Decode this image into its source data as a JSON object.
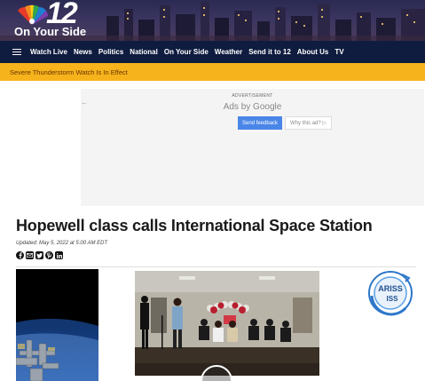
{
  "brand": {
    "channel_number": "12",
    "tagline": "On Your Side"
  },
  "nav": {
    "items": [
      {
        "label": "Watch Live"
      },
      {
        "label": "News"
      },
      {
        "label": "Politics"
      },
      {
        "label": "National"
      },
      {
        "label": "On Your Side"
      },
      {
        "label": "Weather"
      },
      {
        "label": "Send it to 12"
      },
      {
        "label": "About Us"
      },
      {
        "label": "TV"
      }
    ]
  },
  "alert": {
    "text": "Severe Thunderstorm Watch Is In Effect"
  },
  "ad": {
    "label": "ADVERTISEMENT",
    "ads_by": "Ads by Google",
    "feedback_button": "Send feedback",
    "why_button": "Why this ad? ▷"
  },
  "article": {
    "headline": "Hopewell class calls International Space Station",
    "updated": "Updated: May 5, 2022 at 5:00 AM EDT",
    "share_icons": [
      "facebook-icon",
      "email-icon",
      "twitter-icon",
      "pinterest-icon",
      "linkedin-icon"
    ]
  },
  "media": {
    "logo_line1": "ARISS",
    "logo_line2": "ISS"
  },
  "colors": {
    "nav_bg": "#0f1c3f",
    "alert_bg": "#f6b31c",
    "feedback_button": "#4a86e8"
  }
}
